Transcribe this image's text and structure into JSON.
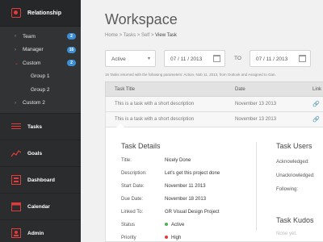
{
  "sidebar": {
    "header": "Relationship",
    "sub_items": [
      {
        "label": "Team",
        "badge": "2"
      },
      {
        "label": "Manager",
        "badge": "16"
      },
      {
        "label": "Custom",
        "badge": "2"
      },
      {
        "label": "Group 1"
      },
      {
        "label": "Group 2"
      },
      {
        "label": "Custom 2"
      }
    ],
    "main_items": [
      {
        "label": "Tasks",
        "icon": "list-icon"
      },
      {
        "label": "Goals",
        "icon": "chart-icon"
      },
      {
        "label": "Dashboard",
        "icon": "dashboard-icon"
      },
      {
        "label": "Calendar",
        "icon": "calendar-icon"
      },
      {
        "label": "Admin",
        "icon": "admin-icon"
      }
    ],
    "accent": "#e23b3b",
    "badge_color": "#3c8fd6"
  },
  "page": {
    "title": "Workspace",
    "breadcrumb": [
      "Home",
      "Tasks",
      "Self",
      "View Task"
    ]
  },
  "filters": {
    "status": "Active",
    "from_date": "07 / 11 / 2013",
    "to_label": "TO",
    "to_date": "07 / 11 / 2013"
  },
  "info_text": "15 Tasks returned with the following parameters: Action, Nob 11, 2013, from Outlook and Assigned to Gan.",
  "table": {
    "headers": [
      "Task Title",
      "Date",
      "Link"
    ],
    "rows": [
      {
        "title": "This is a task with a short description",
        "date": "November 13 2013"
      },
      {
        "title": "This is a task with a short description",
        "date": "November 13 2013"
      }
    ]
  },
  "details": {
    "heading": "Task Details",
    "fields": [
      {
        "label": "Title:",
        "value": "Nicely Done"
      },
      {
        "label": "Description:",
        "value": "Let's get this project done"
      },
      {
        "label": "Start Date:",
        "value": "November 11 2013"
      },
      {
        "label": "Due Date:",
        "value": "November 18 2013"
      },
      {
        "label": "Linked To:",
        "value": "GR Visual Design Project"
      },
      {
        "label": "Status",
        "value": "Active",
        "dot": "#4caf50"
      },
      {
        "label": "Priority",
        "value": "High",
        "dot": "#e23b3b"
      }
    ]
  },
  "users": {
    "heading": "Task Users",
    "fields": [
      "Acknowledged:",
      "Unacknowledged:",
      "Following:"
    ]
  },
  "kudos": {
    "heading": "Task Kudos",
    "empty": "None yet."
  }
}
